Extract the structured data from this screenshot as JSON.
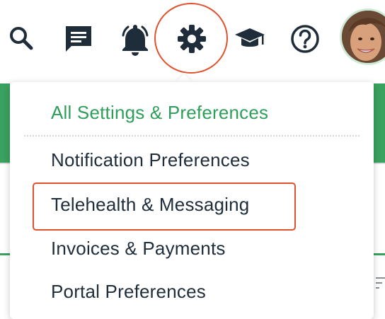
{
  "header": {
    "icons": {
      "search": "search-icon",
      "messages": "chat-icon",
      "notifications": "bell-icon",
      "settings": "gear-icon",
      "learning": "graduation-cap-icon",
      "help": "help-circle-icon",
      "avatar": "user-avatar"
    }
  },
  "settings_menu": {
    "header_link": "All Settings & Preferences",
    "items": [
      "Notification Preferences",
      "Telehealth & Messaging",
      "Invoices & Payments",
      "Portal Preferences"
    ]
  },
  "annotations": {
    "highlighted_icon": "settings",
    "highlighted_item": "Telehealth & Messaging"
  },
  "colors": {
    "icon": "#1f2d3a",
    "accent_green": "#2f9e5b",
    "annotation_red": "#e2512d",
    "text": "#1f2d3a"
  }
}
